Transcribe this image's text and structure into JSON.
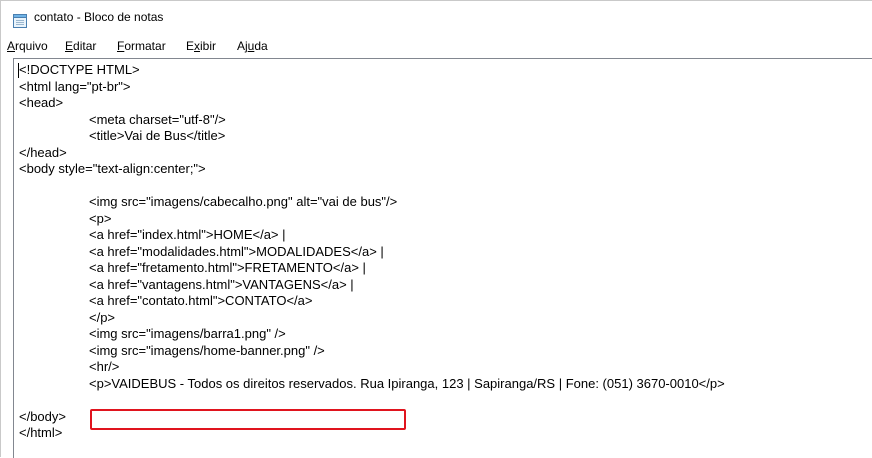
{
  "window": {
    "title": "contato - Bloco de notas",
    "icon": "notepad-icon"
  },
  "menu": {
    "items": [
      {
        "label": "Arquivo",
        "mnemonic": "A"
      },
      {
        "label": "Editar",
        "mnemonic": "E"
      },
      {
        "label": "Formatar",
        "mnemonic": "F"
      },
      {
        "label": "Exibir",
        "mnemonic": "x"
      },
      {
        "label": "Ajuda",
        "mnemonic": "u"
      }
    ]
  },
  "editor": {
    "lines": [
      "<!DOCTYPE HTML>",
      "<html lang=\"pt-br\">",
      "<head>",
      "\t<meta charset=\"utf-8\"/>",
      "\t<title>Vai de Bus</title>",
      "</head>",
      "<body style=\"text-align:center;\">",
      "",
      "\t<img src=\"imagens/cabecalho.png\" alt=\"vai de bus\"/>",
      "\t<p>",
      "\t<a href=\"index.html\">HOME</a> |",
      "\t<a href=\"modalidades.html\">MODALIDADES</a> |",
      "\t<a href=\"fretamento.html\">FRETAMENTO</a> |",
      "\t<a href=\"vantagens.html\">VANTAGENS</a> |",
      "\t<a href=\"contato.html\">CONTATO</a>",
      "\t</p>",
      "\t<img src=\"imagens/barra1.png\" />",
      "\t<img src=\"imagens/home-banner.png\" />",
      "\t<hr/>",
      "\t<p>VAIDEBUS - Todos os direitos reservados. Rua Ipiranga, 123 | Sapiranga/RS | Fone: (051) 3670-0010</p>",
      "",
      "</body>",
      "</html>"
    ],
    "highlighted_line": "\t<img src=\"imagens/home-banner.png\" />",
    "highlight_color": "#e0141e"
  }
}
